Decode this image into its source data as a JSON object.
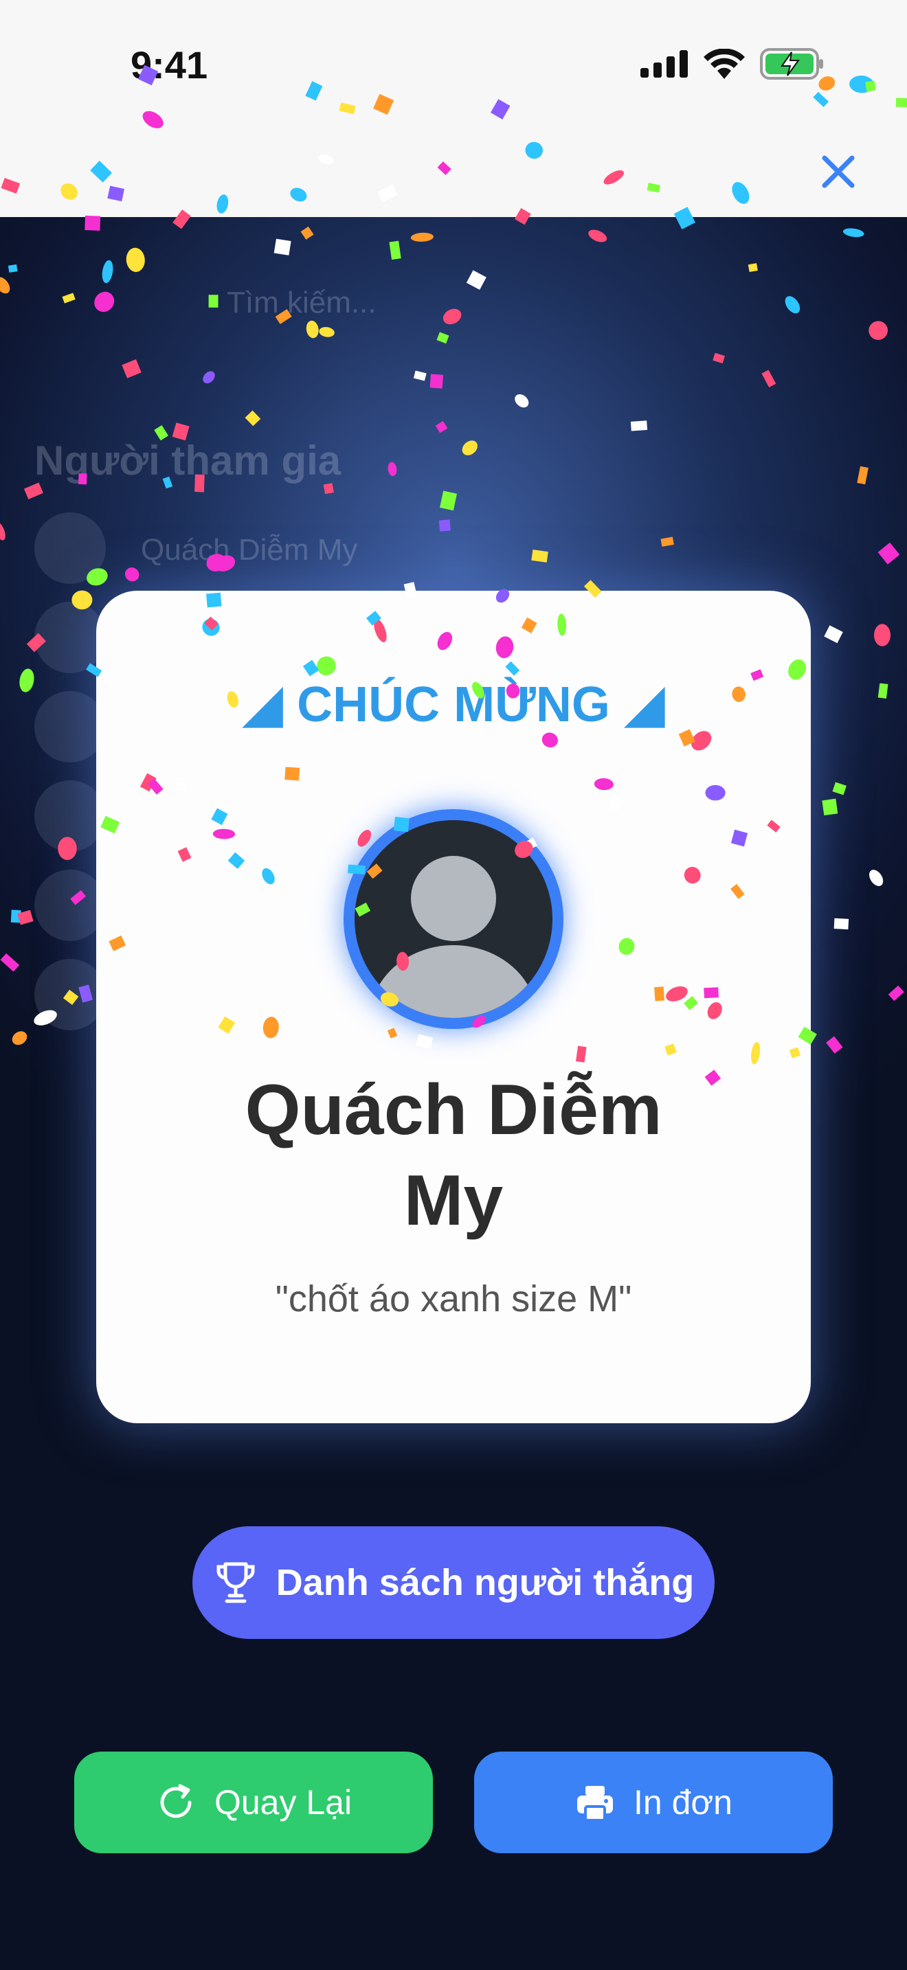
{
  "status_bar": {
    "time": "9:41"
  },
  "background": {
    "search_text": "Tìm kiếm...",
    "heading": "Người tham gia",
    "first_participant": "Quách Diễm My"
  },
  "card": {
    "congrats_title": "CHÚC MỪNG",
    "winner_name_line1": "Quách Diễm",
    "winner_name_line2": "My",
    "winner_comment": "\"chốt áo xanh size M\""
  },
  "buttons": {
    "winners_list": "Danh sách người thắng",
    "replay": "Quay Lại",
    "print": "In đơn"
  },
  "icons": {
    "close": "close-icon",
    "party": "party-popper-icon",
    "trophy": "trophy-icon",
    "replay": "refresh-icon",
    "print": "printer-icon"
  },
  "colors": {
    "accent_blue": "#3b82f6",
    "winners_button": "#5865f6",
    "replay_button": "#2ecc6e",
    "congrats_text": "#2f9be8"
  }
}
